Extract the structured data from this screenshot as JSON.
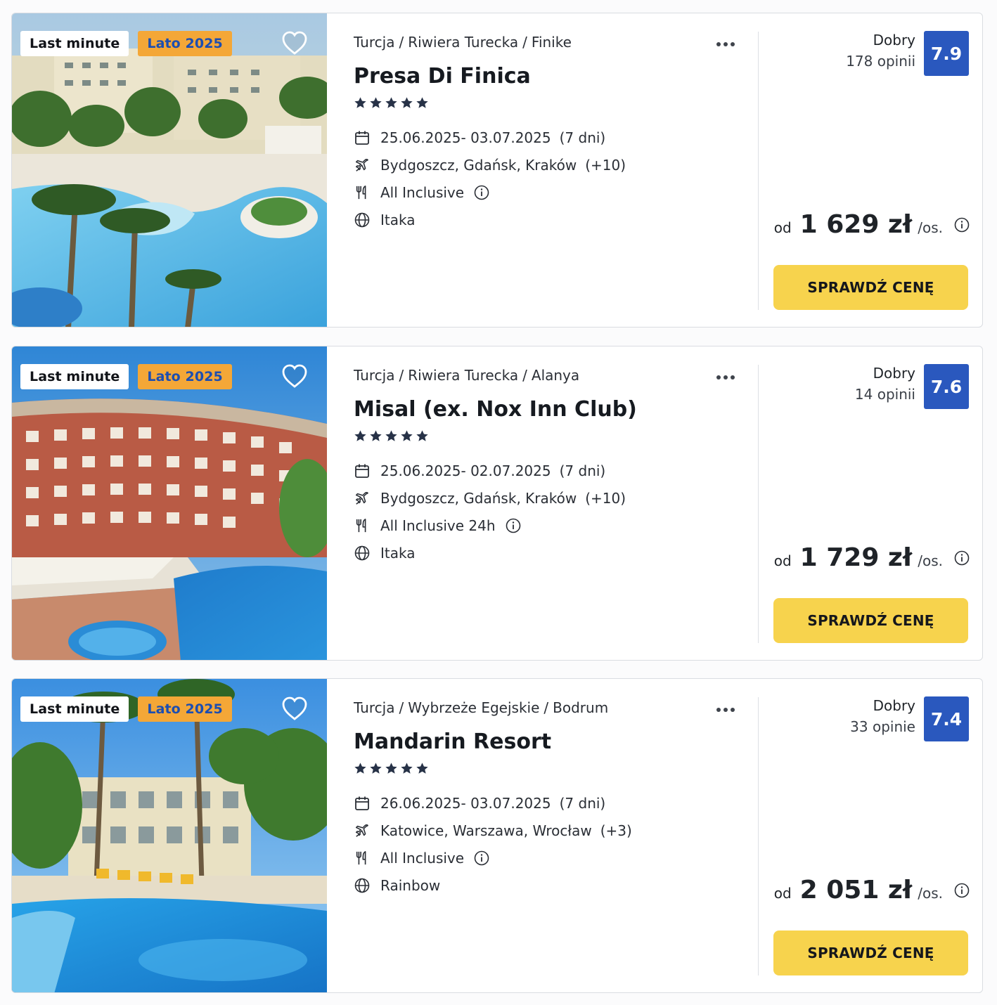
{
  "offers": [
    {
      "badges": {
        "last_minute": "Last minute",
        "season": "Lato 2025"
      },
      "breadcrumb": {
        "country": "Turcja",
        "region": "Riwiera Turecka",
        "city": "Finike",
        "separator": "/"
      },
      "name": "Presa Di Finica",
      "stars": 5,
      "dates": "25.06.2025- 03.07.2025",
      "duration": "(7 dni)",
      "departures": "Bydgoszcz, Gdańsk, Kraków",
      "departures_more": "(+10)",
      "board": "All Inclusive",
      "operator": "Itaka",
      "rating_label": "Dobry",
      "reviews": "178 opinii",
      "score": "7.9",
      "price_prefix": "od",
      "price": "1 629 zł",
      "price_suffix": "/os.",
      "cta": "SPRAWDŹ CENĘ",
      "image": "hotel-pool-palms"
    },
    {
      "badges": {
        "last_minute": "Last minute",
        "season": "Lato 2025"
      },
      "breadcrumb": {
        "country": "Turcja",
        "region": "Riwiera Turecka",
        "city": "Alanya",
        "separator": "/"
      },
      "name": "Misal (ex. Nox Inn Club)",
      "stars": 5,
      "dates": "25.06.2025- 02.07.2025",
      "duration": "(7 dni)",
      "departures": "Bydgoszcz, Gdańsk, Kraków",
      "departures_more": "(+10)",
      "board": "All Inclusive 24h",
      "operator": "Itaka",
      "rating_label": "Dobry",
      "reviews": "14 opinii",
      "score": "7.6",
      "price_prefix": "od",
      "price": "1 729 zł",
      "price_suffix": "/os.",
      "cta": "SPRAWDŹ CENĘ",
      "image": "red-hotel-building-pool"
    },
    {
      "badges": {
        "last_minute": "Last minute",
        "season": "Lato 2025"
      },
      "breadcrumb": {
        "country": "Turcja",
        "region": "Wybrzeże Egejskie",
        "city": "Bodrum",
        "separator": "/"
      },
      "name": "Mandarin Resort",
      "stars": 5,
      "dates": "26.06.2025- 03.07.2025",
      "duration": "(7 dni)",
      "departures": "Katowice, Warszawa, Wrocław",
      "departures_more": "(+3)",
      "board": "All Inclusive",
      "operator": "Rainbow",
      "rating_label": "Dobry",
      "reviews": "33 opinie",
      "score": "7.4",
      "price_prefix": "od",
      "price": "2 051 zł",
      "price_suffix": "/os.",
      "cta": "SPRAWDŹ CENĘ",
      "image": "resort-pool-palms"
    }
  ],
  "colors": {
    "score_bg": "#2a58be",
    "cta_bg": "#f7d34d",
    "season_badge_bg": "#f4a737",
    "season_badge_text": "#1c4eb1"
  },
  "icons": [
    "heart-icon",
    "more-dots-icon",
    "star-icon",
    "calendar-icon",
    "plane-icon",
    "dining-icon",
    "info-icon",
    "globe-icon"
  ]
}
